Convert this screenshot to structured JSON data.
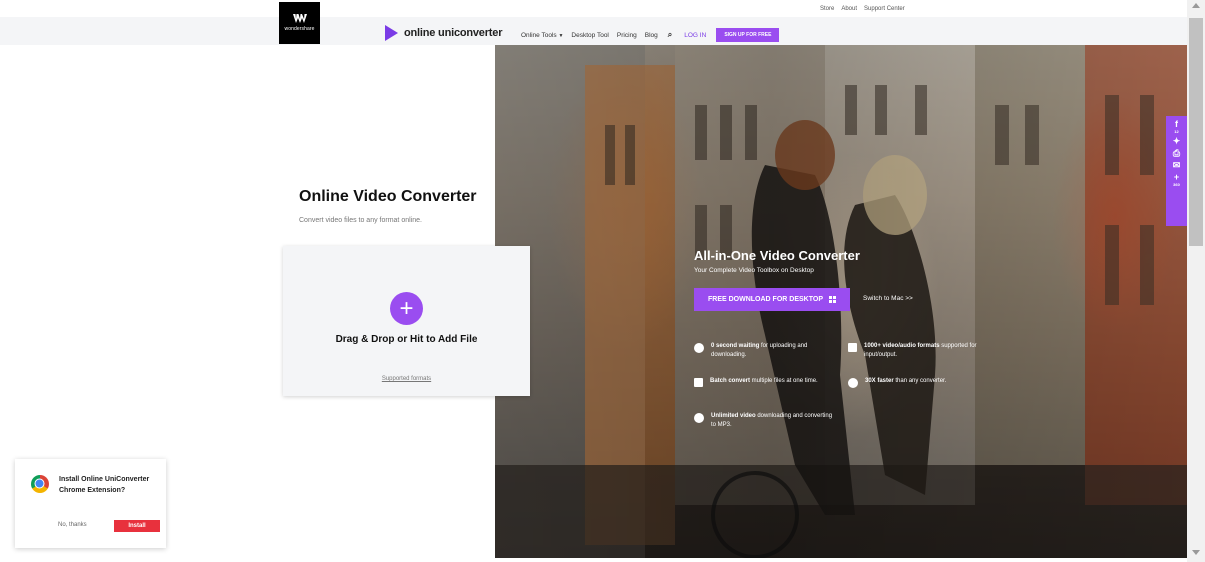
{
  "util_links": [
    "Store",
    "About",
    "Support Center"
  ],
  "brand": {
    "company": "wondershare",
    "product": "online uniconverter"
  },
  "nav": {
    "online_tools": "Online Tools",
    "desktop_tool": "Desktop Tool",
    "pricing": "Pricing",
    "blog": "Blog",
    "login": "LOG IN",
    "signup": "SIGN UP FOR FREE"
  },
  "main": {
    "title": "Online Video Converter",
    "subtitle": "Convert video files to any format online.",
    "upload": {
      "drag_text": "Drag & Drop or Hit to Add File",
      "formats_link": "Supported formats"
    }
  },
  "hero": {
    "title": "All-in-One Video Converter",
    "subtitle": "Your Complete Video Toolbox on Desktop",
    "download_button": "FREE DOWNLOAD FOR DESKTOP",
    "switch_link": "Switch to Mac >>",
    "features": [
      {
        "bold": "0 second waiting",
        "rest": " for uploading and downloading."
      },
      {
        "bold": "1000+ video/audio formats",
        "rest": " supported for input/output."
      },
      {
        "bold": "Batch convert",
        "rest": " multiple files at one time."
      },
      {
        "bold": "30X faster",
        "rest": " than any converter."
      },
      {
        "bold": "Unlimited video",
        "rest": " downloading and converting to MP3."
      }
    ]
  },
  "social": {
    "facebook": "f",
    "facebook_count": "12",
    "twitter": "t",
    "print": "p",
    "email": "e",
    "more": "+",
    "more_count": "360"
  },
  "chrome_prompt": {
    "message": "Install Online UniConverter Chrome Extension?",
    "no_thanks": "No, thanks",
    "install": "Install"
  },
  "colors": {
    "accent": "#9a4df0",
    "install_red": "#e8313d"
  }
}
